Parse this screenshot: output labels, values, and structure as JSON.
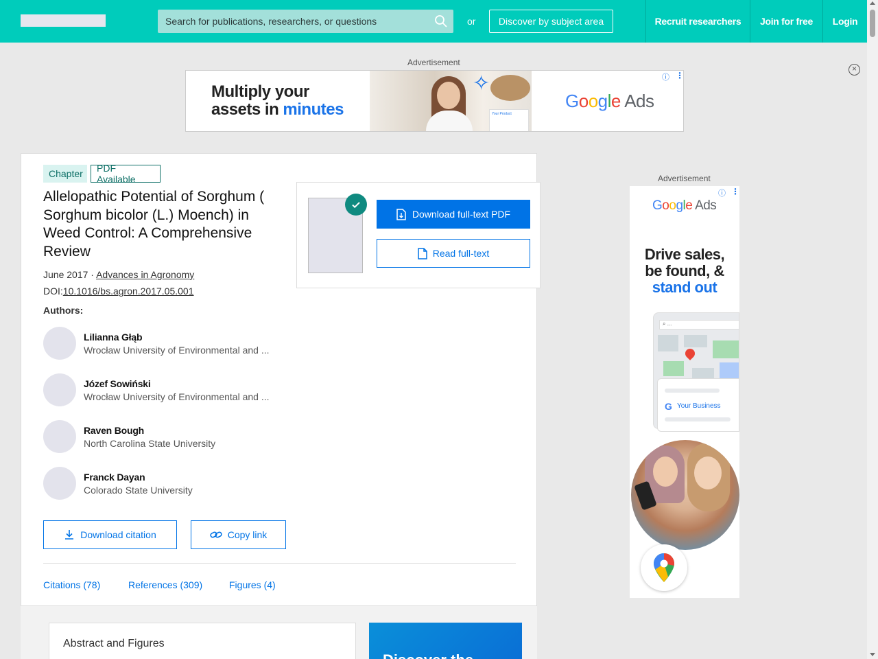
{
  "header": {
    "search_placeholder": "Search for publications, researchers, or questions",
    "or_text": "or",
    "discover_label": "Discover by subject area",
    "nav": {
      "recruit": "Recruit researchers",
      "join": "Join for free",
      "login": "Login"
    },
    "brand_color": "#00ccbb"
  },
  "ads": {
    "label": "Advertisement",
    "top": {
      "headline_line1": "Multiply your",
      "headline_line2_a": "assets in ",
      "headline_line2_b": "minutes",
      "brand_google": "Google",
      "brand_ads": "Ads",
      "product_card_text": "Your Product"
    },
    "side": {
      "brand_google": "Google",
      "brand_ads": "Ads",
      "headline_line1": "Drive sales,",
      "headline_line2": "be found, &",
      "headline_line3": "stand out",
      "business_label": "Your Business",
      "map_search_text": "..."
    },
    "info_symbol": "ⓘ",
    "menu_symbol": "⋮"
  },
  "publication": {
    "type_badge": "Chapter",
    "pdf_badge": "PDF Available",
    "title": "Allelopathic Potential of Sorghum ( Sorghum bicolor (L.) Moench) in Weed Control: A Comprehensive Review",
    "date": "June 2017",
    "separator": " · ",
    "journal": "Advances in Agronomy",
    "doi_label": "DOI:",
    "doi": "10.1016/bs.agron.2017.05.001",
    "authors_label": "Authors:",
    "authors": [
      {
        "name": "Lilianna Głąb",
        "institution": "Wrocław University of Environmental and ..."
      },
      {
        "name": "Józef Sowiński",
        "institution": "Wrocław University of Environmental and ..."
      },
      {
        "name": "Raven Bough",
        "institution": "North Carolina State University"
      },
      {
        "name": "Franck Dayan",
        "institution": "Colorado State University"
      }
    ],
    "actions": {
      "download_citation": "Download citation",
      "copy_link": "Copy link",
      "download_pdf": "Download full-text PDF",
      "read_fulltext": "Read full-text"
    },
    "tabs": {
      "citations": "Citations (78)",
      "references": "References (309)",
      "figures": "Figures (4)"
    },
    "abstract_title": "Abstract and Figures",
    "discover_promo": "Discover the"
  }
}
